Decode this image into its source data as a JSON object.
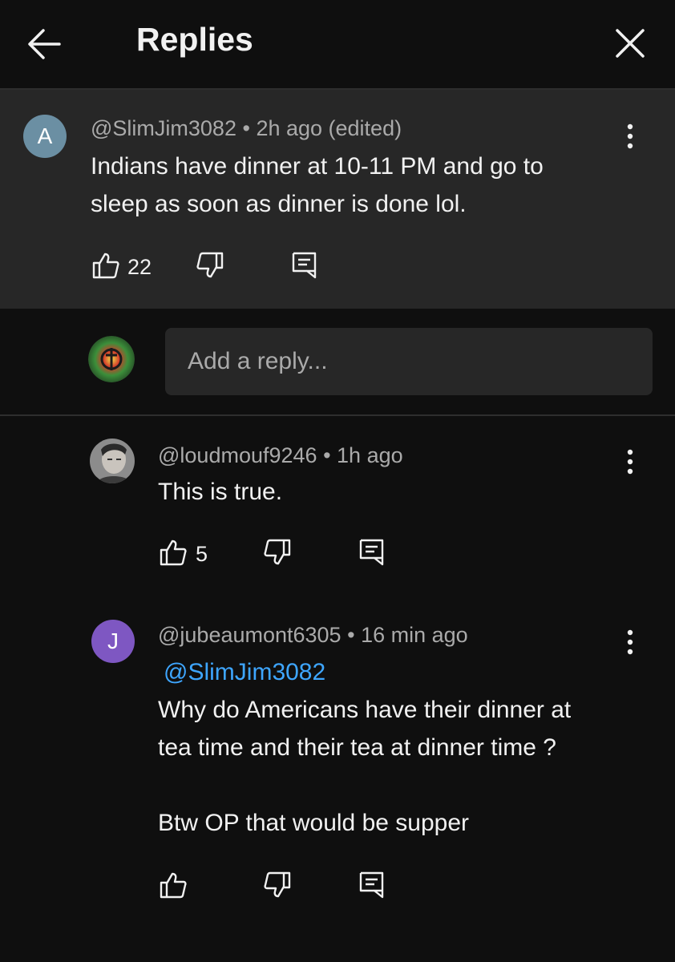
{
  "header": {
    "title": "Replies",
    "back_icon": "arrow-left-icon",
    "close_icon": "close-icon"
  },
  "parent_comment": {
    "avatar_letter": "A",
    "avatar_color": "#6b8fa3",
    "author": "@SlimJim3082",
    "time": "2h ago (edited)",
    "text_line1": "Indians have dinner at 10-11 PM and go to",
    "text_line2": "sleep as soon as dinner is done lol.",
    "likes": "22"
  },
  "reply_box": {
    "placeholder": "Add a reply..."
  },
  "replies": [
    {
      "author": "@loudmouf9246",
      "time": "1h ago",
      "text": "This is true.",
      "likes": "5"
    },
    {
      "avatar_letter": "J",
      "avatar_color": "#7e57c2",
      "author": "@jubeaumont6305",
      "time": "16 min ago",
      "mention": "@SlimJim3082",
      "text_line1": "Why do Americans have their dinner at",
      "text_line2": "tea time and their tea at dinner time ?",
      "text_line3": "Btw OP that would be supper",
      "likes": ""
    }
  ],
  "colors": {
    "background": "#0f0f0f",
    "parent_background": "#272727",
    "mention": "#3ea6ff",
    "meta_text": "#aaaaaa"
  }
}
